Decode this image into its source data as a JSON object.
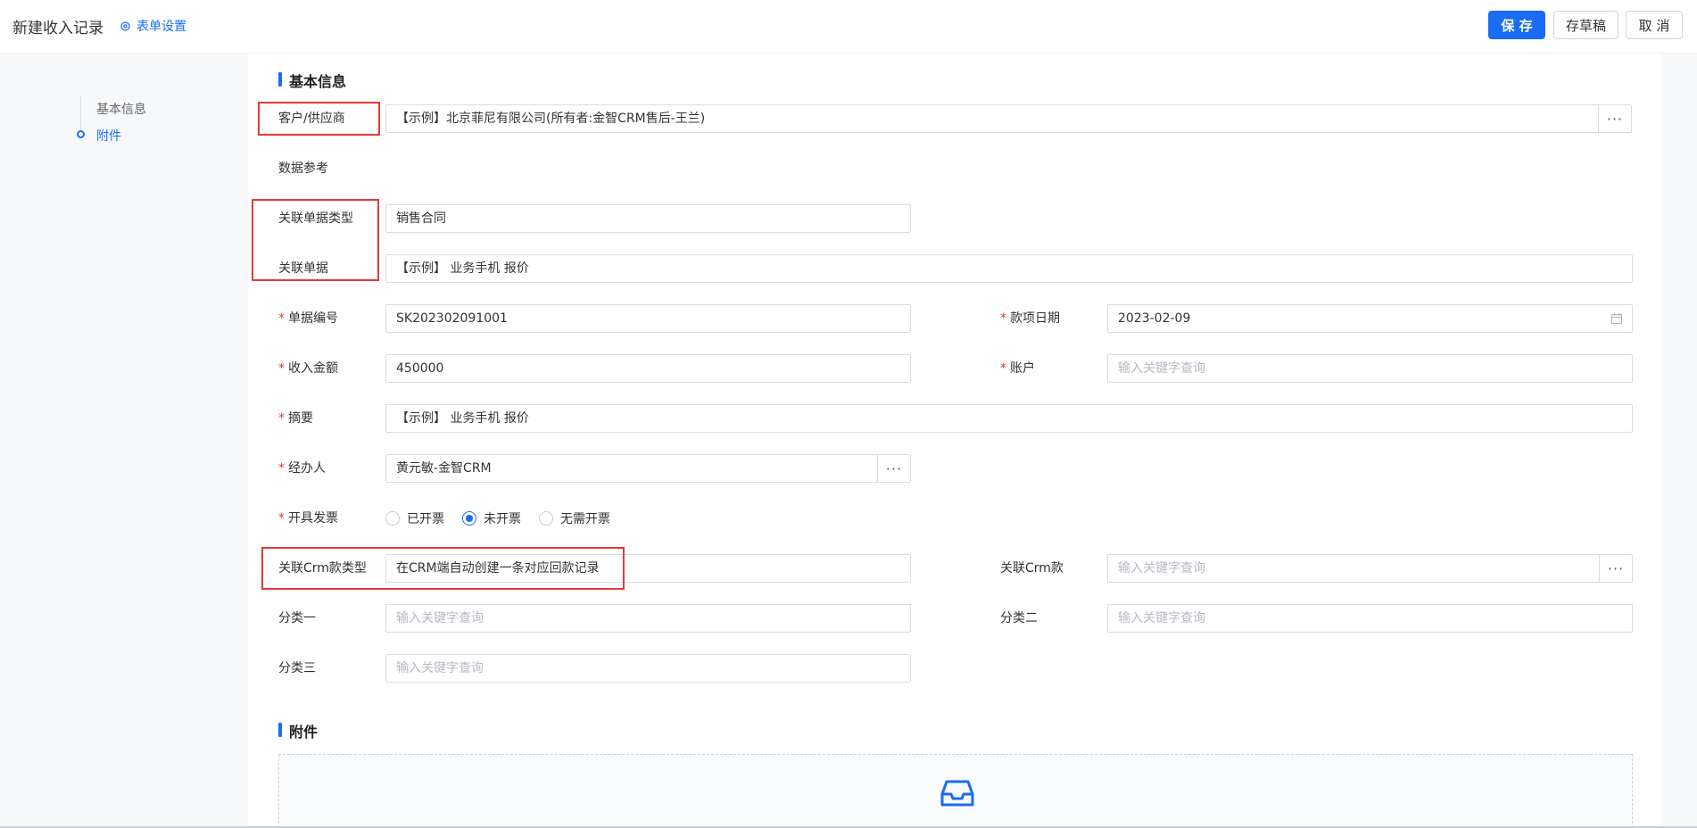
{
  "header": {
    "title": "新建收入记录",
    "form_settings": "表单设置",
    "save": "保 存",
    "draft": "存草稿",
    "cancel": "取 消"
  },
  "nav": {
    "items": [
      {
        "label": "基本信息",
        "active": false
      },
      {
        "label": "附件",
        "active": true
      }
    ]
  },
  "colors": {
    "accent": "#1a6cf3",
    "required": "#e53935",
    "highlight_box": "#e53935"
  },
  "basic_info": {
    "section_title": "基本信息",
    "customer_label": "客户/供应商",
    "customer_value": "【示例】北京菲尼有限公司(所有者:金智CRM售后-王兰)",
    "data_ref_label": "数据参考",
    "related_doc_type_label": "关联单据类型",
    "related_doc_type_value": "销售合同",
    "related_doc_label": "关联单据",
    "related_doc_value": "【示例】 业务手机 报价",
    "doc_no_label": "单据编号",
    "doc_no_value": "SK202302091001",
    "date_label": "款项日期",
    "date_value": "2023-02-09",
    "amount_label": "收入金额",
    "amount_value": "450000",
    "account_label": "账户",
    "account_placeholder": "输入关键字查询",
    "summary_label": "摘要",
    "summary_value": "【示例】 业务手机 报价",
    "handler_label": "经办人",
    "handler_value": "黄元敏-金智CRM",
    "invoice_label": "开具发票",
    "invoice_options": [
      "已开票",
      "未开票",
      "无需开票"
    ],
    "invoice_selected": "未开票",
    "crm_type_label": "关联Crm款类型",
    "crm_type_value": "在CRM端自动创建一条对应回款记录",
    "crm_label": "关联Crm款",
    "crm_placeholder": "输入关键字查询",
    "cat1_label": "分类一",
    "cat1_placeholder": "输入关键字查询",
    "cat2_label": "分类二",
    "cat2_placeholder": "输入关键字查询",
    "cat3_label": "分类三",
    "cat3_placeholder": "输入关键字查询"
  },
  "attachments": {
    "section_title": "附件"
  }
}
